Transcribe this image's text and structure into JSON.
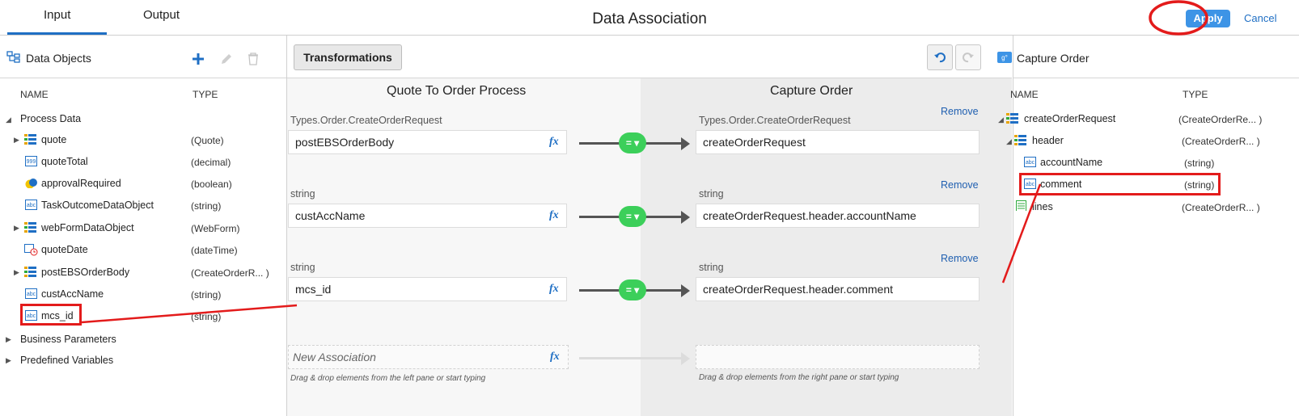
{
  "header": {
    "tabs": [
      {
        "label": "Input"
      },
      {
        "label": "Output"
      }
    ],
    "title": "Data Association",
    "apply_label": "Apply",
    "cancel_label": "Cancel"
  },
  "left": {
    "title": "Data Objects",
    "col_name": "NAME",
    "col_type": "TYPE",
    "groups": {
      "process": "Process Data",
      "business": "Business Parameters",
      "predefined": "Predefined Variables"
    },
    "items": [
      {
        "name": "quote",
        "type": "(Quote)",
        "icon": "structure-icon"
      },
      {
        "name": "quoteTotal",
        "type": "(decimal)",
        "icon": "decimal-icon"
      },
      {
        "name": "approvalRequired",
        "type": "(boolean)",
        "icon": "boolean-icon"
      },
      {
        "name": "TaskOutcomeDataObject",
        "type": "(string)",
        "icon": "string-icon"
      },
      {
        "name": "webFormDataObject",
        "type": "(WebForm)",
        "icon": "structure-icon"
      },
      {
        "name": "quoteDate",
        "type": "(dateTime)",
        "icon": "datetime-icon"
      },
      {
        "name": "postEBSOrderBody",
        "type": "(CreateOrderR... )",
        "icon": "structure-icon"
      },
      {
        "name": "custAccName",
        "type": "(string)",
        "icon": "string-icon"
      },
      {
        "name": "mcs_id",
        "type": "(string)",
        "icon": "string-icon"
      }
    ]
  },
  "middle": {
    "transformations_label": "Transformations",
    "left_title": "Quote To Order Process",
    "right_title": "Capture Order",
    "remove_label": "Remove",
    "eq_label": "=",
    "associations": [
      {
        "source_type": "Types.Order.CreateOrderRequest",
        "source": "postEBSOrderBody",
        "target_type": "Types.Order.CreateOrderRequest",
        "target": "createOrderRequest"
      },
      {
        "source_type": "string",
        "source": "custAccName",
        "target_type": "string",
        "target": "createOrderRequest.header.accountName"
      },
      {
        "source_type": "string",
        "source": "mcs_id",
        "target_type": "string",
        "target": "createOrderRequest.header.comment"
      }
    ],
    "new_association_placeholder": "New Association",
    "hint_left": "Drag & drop elements from the left pane or start typing",
    "hint_right": "Drag & drop elements from the right pane or start typing"
  },
  "right": {
    "title": "Capture Order",
    "col_name": "NAME",
    "col_type": "TYPE",
    "items": [
      {
        "name": "createOrderRequest",
        "type": "(CreateOrderRe... )"
      },
      {
        "name": "header",
        "type": "(CreateOrderR... )"
      },
      {
        "name": "accountName",
        "type": "(string)"
      },
      {
        "name": "comment",
        "type": "(string)"
      },
      {
        "name": "lines",
        "type": "(CreateOrderR... )"
      }
    ]
  },
  "colors": {
    "accent": "#1f6fc4",
    "apply_bg": "#3d94e6",
    "equals_green": "#3ccf5a",
    "annotation_red": "#e31b1b"
  }
}
